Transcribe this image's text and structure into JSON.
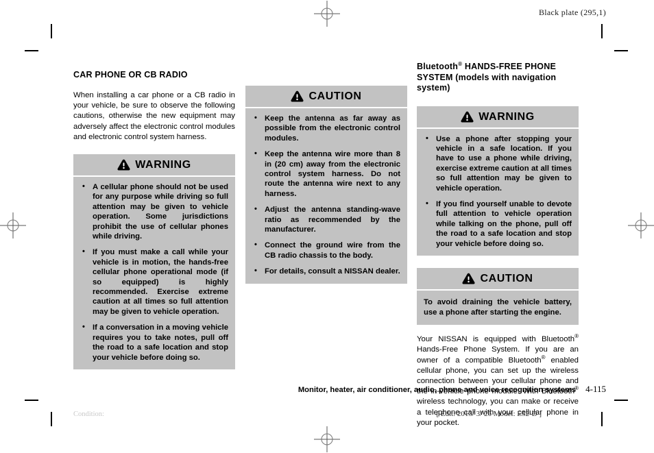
{
  "header": {
    "black_plate": "Black plate (295,1)"
  },
  "left_column": {
    "section_title": "CAR PHONE OR CB RADIO",
    "intro_paragraph": "When installing a car phone or a CB radio in your vehicle, be sure to observe the following cautions, otherwise the new equipment may adversely affect the electronic control modules and electronic control system harness.",
    "warning": {
      "label": "WARNING",
      "icon": "warning-triangle-icon",
      "items": [
        "A cellular phone should not be used for any purpose while driving so full attention may be given to vehicle operation. Some jurisdictions prohibit the use of cellular phones while driving.",
        "If you must make a call while your vehicle is in motion, the hands-free cellular phone operational mode (if so equipped) is highly recommended. Exercise extreme caution at all times so full attention may be given to vehicle operation.",
        "If a conversation in a moving vehicle requires you to take notes, pull off the road to a safe location and stop your vehicle before doing so."
      ]
    }
  },
  "middle_column": {
    "caution": {
      "label": "CAUTION",
      "icon": "warning-triangle-icon",
      "items": [
        "Keep the antenna as far away as possible from the electronic control modules.",
        "Keep the antenna wire more than 8 in (20 cm) away from the electronic control system harness. Do not route the antenna wire next to any harness.",
        "Adjust the antenna standing-wave ratio as recommended by the manufacturer.",
        "Connect the ground wire from the CB radio chassis to the body.",
        "For details, consult a NISSAN dealer."
      ]
    }
  },
  "right_column": {
    "section_title_part1": "Bluetooth",
    "section_title_sup": "®",
    "section_title_part2": " HANDS-FREE PHONE SYSTEM (models with navigation system)",
    "warning": {
      "label": "WARNING",
      "icon": "warning-triangle-icon",
      "items": [
        "Use a phone after stopping your vehicle in a safe location. If you have to use a phone while driving, exercise extreme caution at all times so full attention may be given to vehicle operation.",
        "If you find yourself unable to devote full attention to vehicle operation while talking on the phone, pull off the road to a safe location and stop your vehicle before doing so."
      ]
    },
    "caution": {
      "label": "CAUTION",
      "icon": "warning-triangle-icon",
      "text": "To avoid draining the vehicle battery, use a phone after starting the engine."
    },
    "body_paragraph": {
      "seg1": "Your NISSAN is equipped with Bluetooth",
      "sup1": "®",
      "seg2": " Hands-Free Phone System. If you are an owner of a compatible Bluetooth",
      "sup2": "®",
      "seg3": " enabled cellular phone, you can set up the wireless connection between your cellular phone and the in-vehicle phone module. With Bluetooth",
      "sup3": "®",
      "seg4": " wireless technology, you can make or receive a telephone call with your cellular phone in your pocket."
    }
  },
  "footer": {
    "running_title": "Monitor, heater, air conditioner, audio, phone and voice recognition systems",
    "page_number": "4-115",
    "condition_label": "Condition:",
    "edit_stamp": "[ Edit: 2013/ 3/ 26   Model: E52-D ]"
  },
  "colors": {
    "alert_gray": "#c2c2c2",
    "text_black": "#000000",
    "condition_gray": "#c9c9c9"
  }
}
